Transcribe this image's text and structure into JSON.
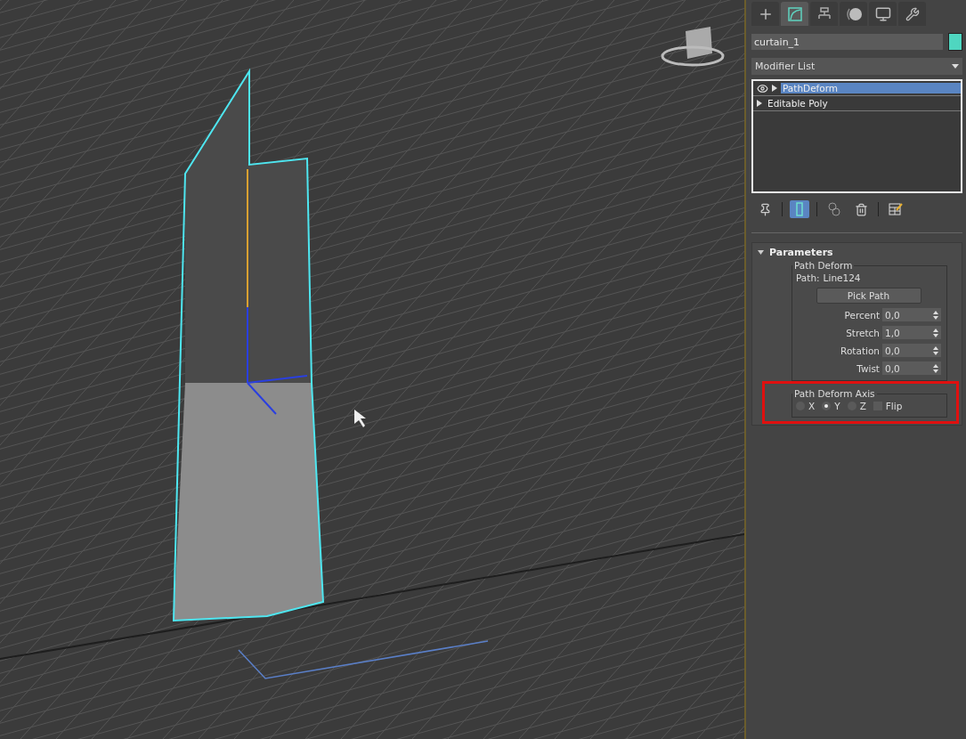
{
  "command_tabs": [
    {
      "kind": "create",
      "selected": false
    },
    {
      "kind": "modify",
      "selected": true
    },
    {
      "kind": "hierarchy",
      "selected": false
    },
    {
      "kind": "motion",
      "selected": false
    },
    {
      "kind": "display",
      "selected": false
    },
    {
      "kind": "utilities",
      "selected": false
    }
  ],
  "object": {
    "name": "curtain_1",
    "color": "#4fd6c0"
  },
  "modifier_list": {
    "label": "Modifier List"
  },
  "stack": [
    {
      "kind": "modifier",
      "label": "PathDeform",
      "selected": true
    },
    {
      "kind": "base",
      "label": "Editable Poly",
      "selected": false
    }
  ],
  "stack_tools": [
    {
      "kind": "pin",
      "selected": false
    },
    {
      "kind": "end-result",
      "selected": true
    },
    {
      "kind": "unique",
      "selected": false
    },
    {
      "kind": "remove",
      "selected": false
    },
    {
      "kind": "configure",
      "selected": false
    }
  ],
  "rollout": {
    "title": "Parameters",
    "expanded": true,
    "path_group": {
      "title": "Path Deform",
      "path_label": "Path:",
      "path_value": "Line124",
      "pick_button": "Pick Path",
      "spinners": [
        {
          "label": "Percent",
          "value": "0,0"
        },
        {
          "label": "Stretch",
          "value": "1,0"
        },
        {
          "label": "Rotation",
          "value": "0,0"
        },
        {
          "label": "Twist",
          "value": "0,0"
        }
      ]
    },
    "axis_group": {
      "title": "Path Deform Axis",
      "highlighted": true,
      "axes": [
        {
          "label": "X",
          "selected": false
        },
        {
          "label": "Y",
          "selected": true
        },
        {
          "label": "Z",
          "selected": false
        }
      ],
      "flip": {
        "label": "Flip",
        "checked": false
      }
    }
  }
}
